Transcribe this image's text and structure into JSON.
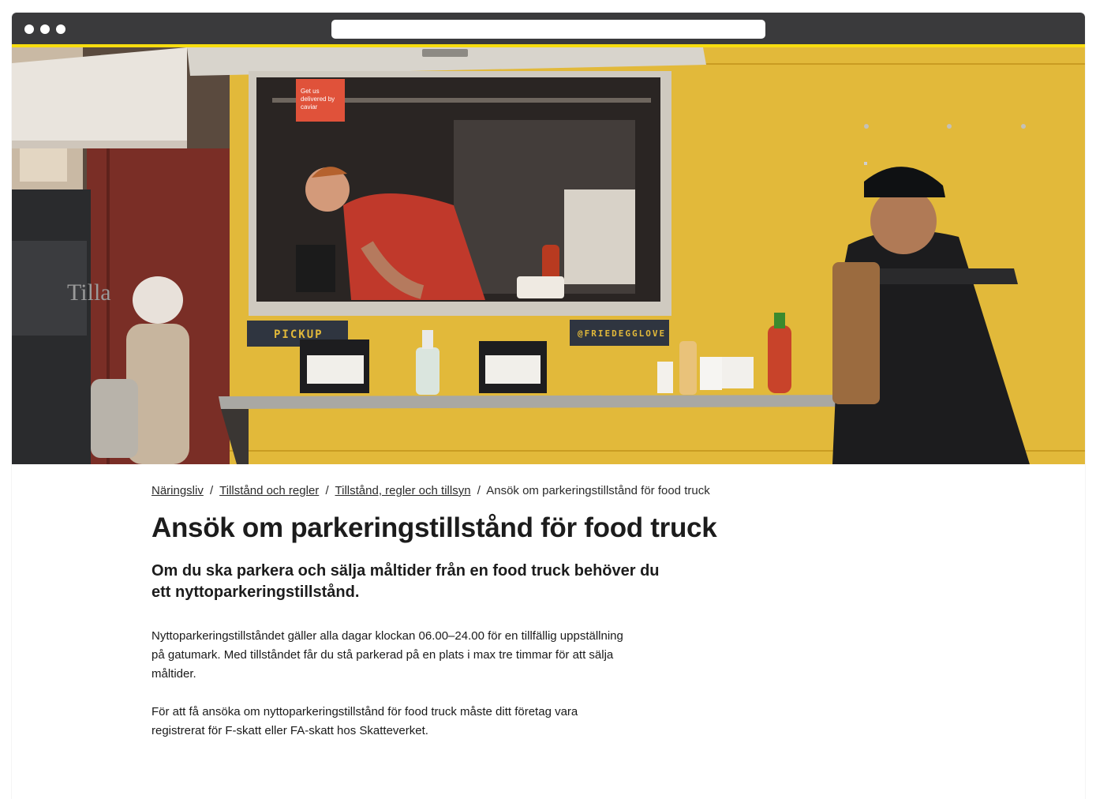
{
  "browser": {
    "url": ""
  },
  "hero": {
    "sign_pickup": "PICKUP",
    "sign_handle": "@FRIEDEGGLOVE",
    "window_sticker": "Get us delivered by caviar",
    "side_truck_text": "Tilla",
    "colors": {
      "truck_yellow": "#e2b93a",
      "accent_bar": "#f7dd0f"
    }
  },
  "breadcrumb": {
    "items": [
      {
        "label": "Näringsliv"
      },
      {
        "label": "Tillstånd och regler"
      },
      {
        "label": "Tillstånd, regler och tillsyn"
      }
    ],
    "current": "Ansök om parkeringstillstånd för food truck",
    "separator": "/"
  },
  "page": {
    "title": "Ansök om parkeringstillstånd för food truck",
    "lead": "Om du ska parkera och sälja måltider från en food truck behöver du ett nyttoparkeringstillstånd.",
    "paragraphs": [
      "Nyttoparkeringstillståndet gäller alla dagar klockan 06.00–24.00 för en tillfällig uppställning på gatumark. Med tillståndet får du stå parkerad på en plats i max tre timmar för att sälja måltider.",
      "För att få ansöka om nyttoparkeringstillstånd för food truck måste ditt företag vara registrerat för F-skatt eller FA-skatt hos Skatteverket."
    ]
  }
}
